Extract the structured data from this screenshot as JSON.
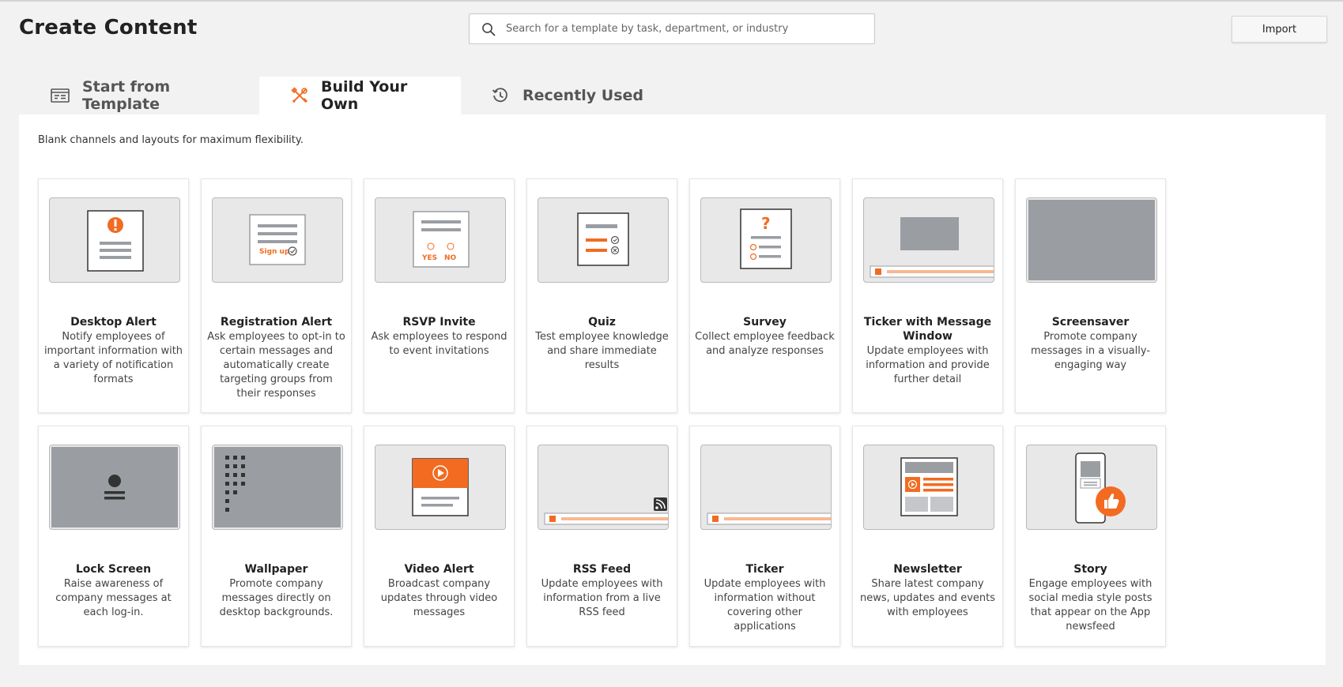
{
  "header": {
    "title": "Create Content",
    "search_placeholder": "Search for a template by task, department, or industry",
    "import_label": "Import"
  },
  "tabs": [
    {
      "label": "Start from Template",
      "icon": "template-card-icon",
      "active": false
    },
    {
      "label": "Build Your Own",
      "icon": "tools-icon",
      "active": true
    },
    {
      "label": "Recently Used",
      "icon": "history-icon",
      "active": false
    }
  ],
  "panel": {
    "description": "Blank channels and layouts for maximum flexibility."
  },
  "colors": {
    "accent": "#f26b21",
    "thumb_gray": "#9a9ea3",
    "thumb_bg": "#e8e8e9"
  },
  "cards": [
    {
      "title": "Desktop Alert",
      "description": "Notify employees of important information with a variety of notification formats",
      "icon": "desktop-alert-icon"
    },
    {
      "title": "Registration Alert",
      "description": "Ask employees to opt-in to certain messages and automatically create targeting groups from their responses",
      "icon": "registration-alert-icon",
      "thumb_text": "Sign up"
    },
    {
      "title": "RSVP Invite",
      "description": "Ask employees to respond to event invitations",
      "icon": "rsvp-invite-icon",
      "thumb_yes": "YES",
      "thumb_no": "NO"
    },
    {
      "title": "Quiz",
      "description": "Test employee knowledge and share immediate results",
      "icon": "quiz-icon"
    },
    {
      "title": "Survey",
      "description": "Collect employee feedback and analyze responses",
      "icon": "survey-icon",
      "thumb_text": "?"
    },
    {
      "title": "Ticker with Message Window",
      "description": "Update employees with information and provide further detail",
      "icon": "ticker-window-icon"
    },
    {
      "title": "Screensaver",
      "description": "Promote company messages in a visually-engaging way",
      "icon": "screensaver-icon"
    },
    {
      "title": "Lock Screen",
      "description": "Raise awareness of company messages at each log-in.",
      "icon": "lock-screen-icon"
    },
    {
      "title": "Wallpaper",
      "description": "Promote company messages directly on desktop backgrounds.",
      "icon": "wallpaper-icon"
    },
    {
      "title": "Video Alert",
      "description": "Broadcast company updates through video messages",
      "icon": "video-alert-icon"
    },
    {
      "title": "RSS Feed",
      "description": "Update employees with information from a live RSS feed",
      "icon": "rss-feed-icon"
    },
    {
      "title": "Ticker",
      "description": "Update employees with information without covering other applications",
      "icon": "ticker-icon"
    },
    {
      "title": "Newsletter",
      "description": "Share latest company news, updates and events with employees",
      "icon": "newsletter-icon"
    },
    {
      "title": "Story",
      "description": "Engage employees with social media style posts that appear on the App newsfeed",
      "icon": "story-icon"
    }
  ]
}
